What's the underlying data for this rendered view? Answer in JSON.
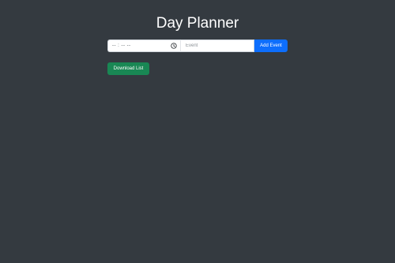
{
  "page": {
    "title": "Day Planner"
  },
  "form": {
    "time_placeholder": "-- : -- --",
    "time_icon": "clock-icon",
    "event_placeholder": "Event",
    "event_value": "",
    "add_label": "Add Event"
  },
  "actions": {
    "download_label": "Download List"
  },
  "colors": {
    "background": "#343a40",
    "primary": "#0d6efd",
    "success": "#198754",
    "text": "#ffffff"
  }
}
